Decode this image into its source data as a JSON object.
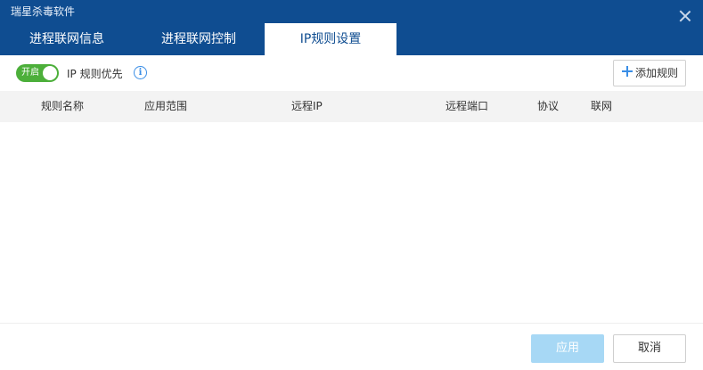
{
  "window": {
    "title": "瑞星杀毒软件"
  },
  "tabs": [
    {
      "label": "进程联网信息"
    },
    {
      "label": "进程联网控制"
    },
    {
      "label": "IP规则设置",
      "active": true
    }
  ],
  "toolbar": {
    "toggle_label": "开启",
    "toggle_on": true,
    "priority_label": "IP 规则优先",
    "add_rule_label": "添加规则"
  },
  "table": {
    "columns": [
      "规则名称",
      "应用范围",
      "远程IP",
      "远程端口",
      "协议",
      "联网"
    ],
    "rows": []
  },
  "footer": {
    "apply_label": "应用",
    "cancel_label": "取消"
  },
  "colors": {
    "titlebar": "#0f4d91",
    "toggle_on": "#4caf3a",
    "accent": "#3a8ee6",
    "apply_disabled": "#a7d8f5"
  }
}
